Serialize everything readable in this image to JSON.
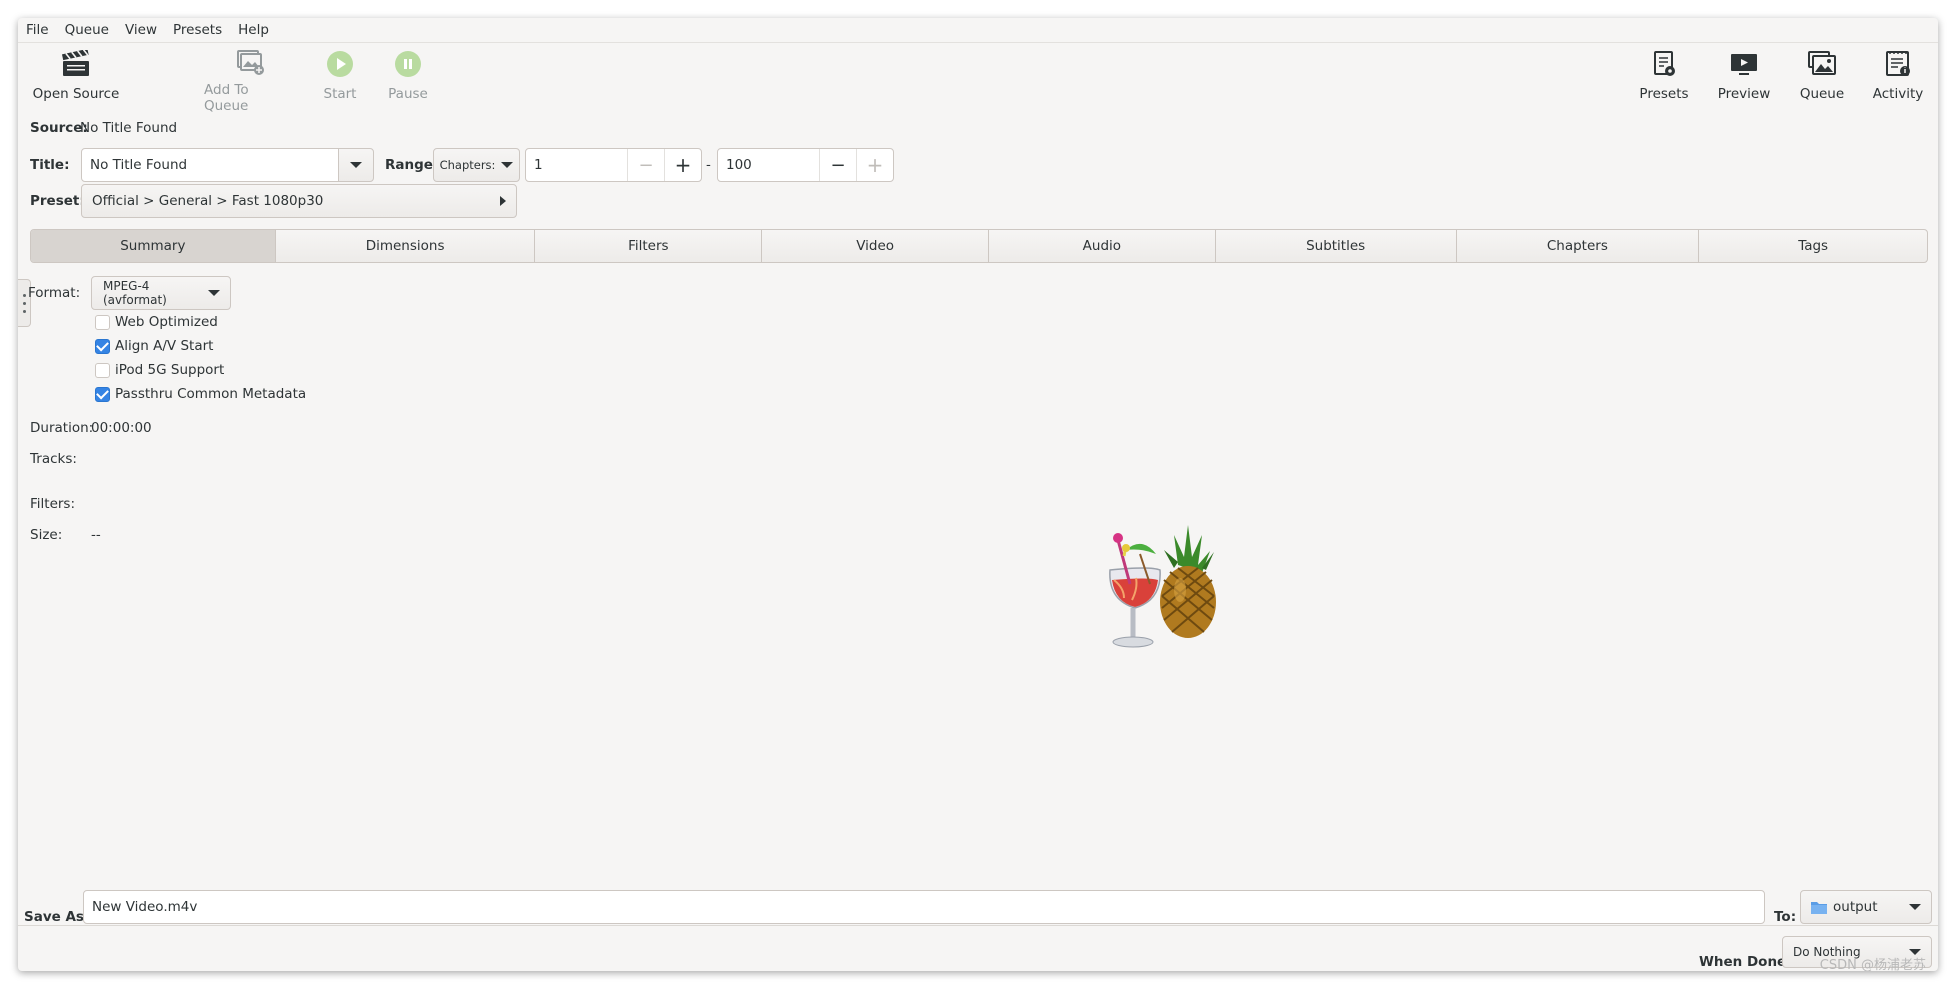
{
  "menu": [
    "File",
    "Queue",
    "View",
    "Presets",
    "Help"
  ],
  "toolbar": {
    "open_source": "Open Source",
    "add_to_queue": "Add To Queue",
    "start": "Start",
    "pause": "Pause",
    "presets": "Presets",
    "preview": "Preview",
    "queue": "Queue",
    "activity": "Activity"
  },
  "source": {
    "label": "Source:",
    "value": "No Title Found"
  },
  "title": {
    "label": "Title:",
    "value": "No Title Found"
  },
  "range": {
    "label": "Range:",
    "mode": "Chapters:",
    "start": "1",
    "separator": "-",
    "end": "100"
  },
  "preset": {
    "label": "Preset:",
    "value": "Official > General > Fast 1080p30"
  },
  "tabs": [
    "Summary",
    "Dimensions",
    "Filters",
    "Video",
    "Audio",
    "Subtitles",
    "Chapters",
    "Tags"
  ],
  "active_tab": "Summary",
  "summary": {
    "format_label": "Format:",
    "format_value": "MPEG-4 (avformat)",
    "options": [
      {
        "label": "Web Optimized",
        "checked": false
      },
      {
        "label": "Align A/V Start",
        "checked": true
      },
      {
        "label": "iPod 5G Support",
        "checked": false
      },
      {
        "label": "Passthru Common Metadata",
        "checked": true
      }
    ],
    "duration_label": "Duration:",
    "duration_value": "00:00:00",
    "tracks_label": "Tracks:",
    "filters_label": "Filters:",
    "size_label": "Size:",
    "size_value": "--"
  },
  "save_as": {
    "label": "Save As:",
    "value": "New Video.m4v"
  },
  "destination": {
    "label": "To:",
    "value": "output"
  },
  "when_done": {
    "label": "When Done:",
    "value": "Do Nothing"
  },
  "watermark": "CSDN @杨浦老苏",
  "colors": {
    "window_bg": "#f6f5f4",
    "accent": "#3584e4",
    "disabled_text": "#949a9c"
  }
}
